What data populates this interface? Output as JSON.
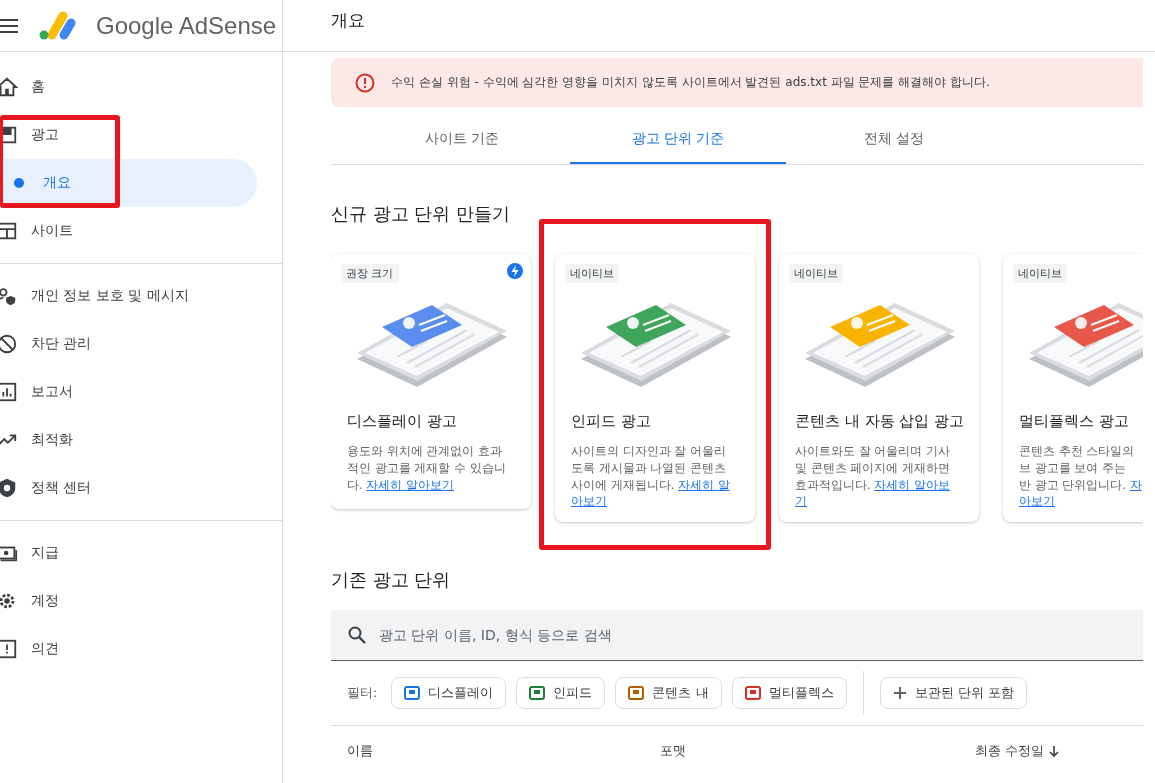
{
  "app": {
    "product": "Google AdSense",
    "page_title": "개요"
  },
  "sidebar": {
    "items": [
      {
        "kind": "home",
        "label": "홈",
        "selected": false,
        "highlighted": false,
        "divider_after": false
      },
      {
        "kind": "ads",
        "label": "광고",
        "selected": false,
        "highlighted": true,
        "divider_after": false,
        "children": [
          {
            "label": "개요",
            "selected": true
          }
        ]
      },
      {
        "kind": "sites",
        "label": "사이트",
        "selected": false,
        "highlighted": false,
        "divider_after": true
      },
      {
        "kind": "privacy",
        "label": "개인 정보 보호 및 메시지",
        "selected": false,
        "highlighted": false,
        "divider_after": false
      },
      {
        "kind": "block",
        "label": "차단 관리",
        "selected": false,
        "highlighted": false,
        "divider_after": false
      },
      {
        "kind": "reports",
        "label": "보고서",
        "selected": false,
        "highlighted": false,
        "divider_after": false
      },
      {
        "kind": "optimize",
        "label": "최적화",
        "selected": false,
        "highlighted": false,
        "divider_after": false
      },
      {
        "kind": "policy",
        "label": "정책 센터",
        "selected": false,
        "highlighted": false,
        "divider_after": true
      },
      {
        "kind": "payments",
        "label": "지급",
        "selected": false,
        "highlighted": false,
        "divider_after": false
      },
      {
        "kind": "account",
        "label": "계정",
        "selected": false,
        "highlighted": false,
        "divider_after": false
      },
      {
        "kind": "feedback",
        "label": "의견",
        "selected": false,
        "highlighted": false,
        "divider_after": false
      }
    ]
  },
  "alert": {
    "text": "수익 손실 위험 - 수익에 심각한 영향을 미치지 않도록 사이트에서 발견된 ads.txt 파일 문제를 해결해야 합니다."
  },
  "tabs": [
    {
      "label": "사이트 기준",
      "selected": false
    },
    {
      "label": "광고 단위 기준",
      "selected": true
    },
    {
      "label": "전체 설정",
      "selected": false
    }
  ],
  "new_ad_units": {
    "heading": "신규 광고 단위 만들기",
    "cards": [
      {
        "kind": "display",
        "badge": "권장 크기",
        "flash": true,
        "highlighted": false,
        "title": "디스플레이 광고",
        "lines": [
          {
            "text": "용도와 위치에 관계없이 효과"
          },
          {
            "text": "적인 광고를 게재할 수 있습니"
          },
          {
            "text": "다. ",
            "link": "자세히 알아보기"
          }
        ]
      },
      {
        "kind": "infeed",
        "badge": "네이티브",
        "flash": false,
        "highlighted": true,
        "title": "인피드 광고",
        "lines": [
          {
            "text": "사이트의 디자인과 잘 어울리"
          },
          {
            "text": "도록 게시물과 나열된 콘텐츠"
          },
          {
            "text": "사이에 게재됩니다. ",
            "link": "자세히 알"
          },
          {
            "link": "아보기"
          }
        ]
      },
      {
        "kind": "inarticle",
        "badge": "네이티브",
        "flash": false,
        "highlighted": false,
        "title": "콘텐츠 내 자동 삽입 광고",
        "lines": [
          {
            "text": "사이트와도 잘 어울리며 기사"
          },
          {
            "text": "및 콘텐츠 페이지에 게재하면"
          },
          {
            "text": "효과적입니다. ",
            "link": "자세히 알아보"
          },
          {
            "link": "기"
          }
        ]
      },
      {
        "kind": "multiplex",
        "badge": "네이티브",
        "flash": false,
        "highlighted": false,
        "title": "멀티플렉스 광고",
        "lines": [
          {
            "text": "콘텐츠 추천 스타일의"
          },
          {
            "text": "브 광고를 보여 주는"
          },
          {
            "text": "반 광고 단위입니다. ",
            "link": "자"
          },
          {
            "link": "아보기"
          }
        ]
      }
    ]
  },
  "existing_ad_units": {
    "heading": "기존 광고 단위",
    "search": {
      "placeholder": "광고 단위 이름, ID, 형식 등으로 검색"
    },
    "filter_label": "필터:",
    "filters": [
      {
        "label": "디스플레이",
        "color": "#1a73e8"
      },
      {
        "label": "인피드",
        "color": "#188038"
      },
      {
        "label": "콘텐츠 내",
        "color": "#b06000"
      },
      {
        "label": "멀티플렉스",
        "color": "#d93025"
      }
    ],
    "archived_toggle": {
      "label": "보관된 단위 포함"
    },
    "table": {
      "columns": [
        {
          "label": "이름",
          "sorted": false
        },
        {
          "label": "포맷",
          "sorted": false
        },
        {
          "label": "최종 수정일",
          "sorted": true
        }
      ]
    }
  }
}
